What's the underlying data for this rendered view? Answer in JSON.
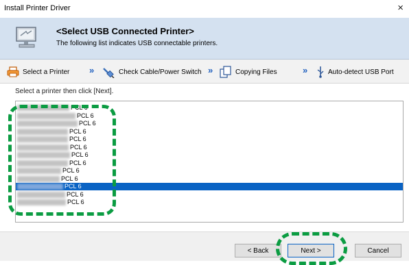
{
  "window": {
    "title": "Install Printer Driver",
    "close_glyph": "×"
  },
  "banner": {
    "heading": "<Select USB Connected Printer>",
    "subtitle": "The following list indicates USB connectable printers.",
    "icon": "computer-monitor-icon"
  },
  "steps": [
    {
      "label": "Select a Printer",
      "icon": "printer-icon"
    },
    {
      "label": "Check Cable/Power Switch",
      "icon": "cable-plug-icon"
    },
    {
      "label": "Copying Files",
      "icon": "copy-files-icon"
    },
    {
      "label": "Auto-detect USB Port",
      "icon": "usb-icon"
    }
  ],
  "step_arrow": "»",
  "instruction": "Select a printer then click [Next].",
  "printers": [
    {
      "label": "PCL 6",
      "selected": false
    },
    {
      "label": "PCL 6",
      "selected": false
    },
    {
      "label": "PCL 6",
      "selected": false
    },
    {
      "label": "PCL 6",
      "selected": false
    },
    {
      "label": "PCL 6",
      "selected": false
    },
    {
      "label": "PCL 6",
      "selected": false
    },
    {
      "label": "PCL 6",
      "selected": false
    },
    {
      "label": "PCL 6",
      "selected": false
    },
    {
      "label": "PCL 6",
      "selected": false
    },
    {
      "label": "PCL 6",
      "selected": false
    },
    {
      "label": "PCL 6",
      "selected": true
    },
    {
      "label": "PCL 6",
      "selected": false
    },
    {
      "label": "PCL 6",
      "selected": false
    }
  ],
  "buttons": {
    "back": "< Back",
    "next": "Next >",
    "cancel": "Cancel"
  },
  "colors": {
    "selection": "#0a63c4",
    "highlight": "#0b9c42",
    "banner": "#d4e1f0"
  }
}
